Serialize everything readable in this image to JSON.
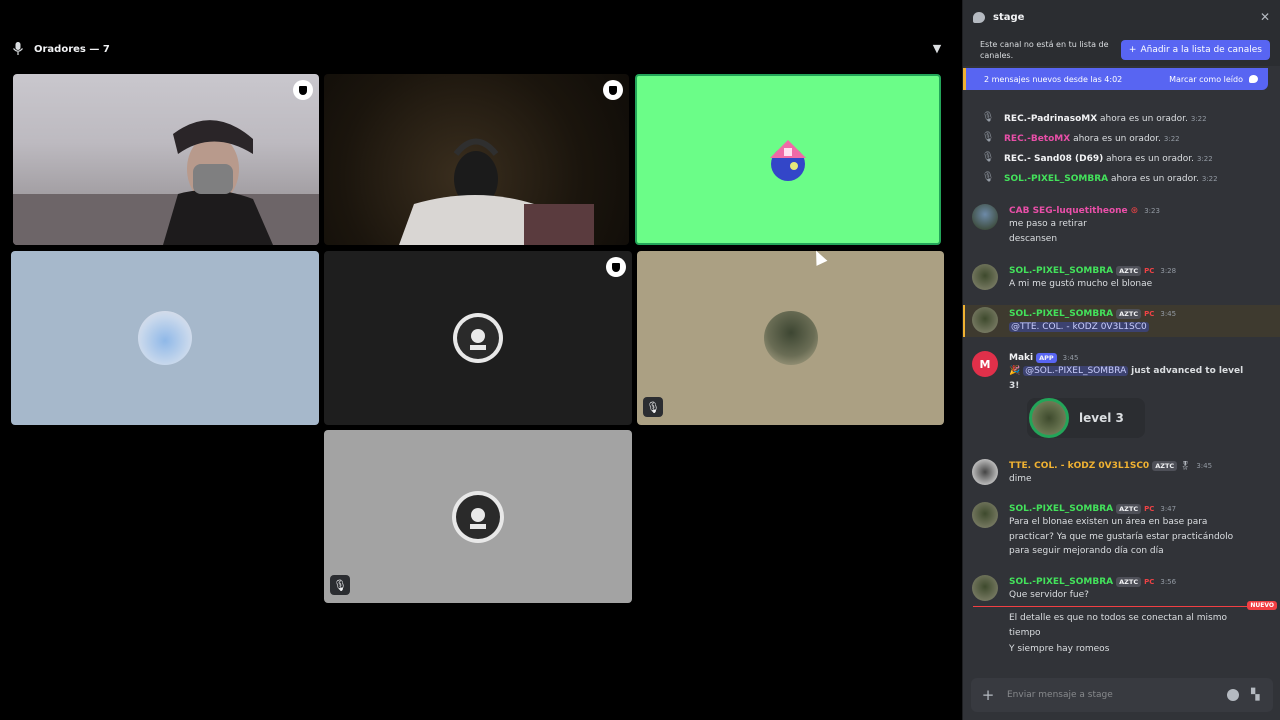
{
  "stage": {
    "speakers_label": "Oradores — 7"
  },
  "chat": {
    "channel_name": "stage",
    "notice_text": "Este canal no está en tu lista de canales.",
    "add_button_label": "Añadir a la lista de canales",
    "new_messages_text": "2 mensajes nuevos desde las 4:02",
    "mark_read_label": "Marcar como leído",
    "system_messages": [
      {
        "user": "REC.-PadrinasoMX",
        "user_color": "#f2f3f5",
        "text": "ahora es un orador.",
        "time": "3:22"
      },
      {
        "user": "REC.-BetoMX",
        "user_color": "#e94fa8",
        "text": "ahora es un orador.",
        "time": "3:22"
      },
      {
        "user": "REC.- Sand08 (D69)",
        "user_color": "#f2f3f5",
        "text": "ahora es un orador.",
        "time": "3:22"
      },
      {
        "user": "SOL.-PIXEL_SOMBRA",
        "user_color": "#43e25b",
        "text": "ahora es un orador.",
        "time": "3:22"
      }
    ],
    "messages": [
      {
        "user": "CAB SEG-luquetitheone",
        "user_color": "#e94fa8",
        "time": "3:23",
        "lines": [
          "me paso a retirar",
          "descansen"
        ]
      },
      {
        "user": "SOL.-PIXEL_SOMBRA",
        "user_color": "#43e25b",
        "tag": "AZTC",
        "badge": "PC",
        "time": "3:28",
        "lines": [
          "A mi me gustó mucho el blonae"
        ]
      },
      {
        "user": "SOL.-PIXEL_SOMBRA",
        "user_color": "#43e25b",
        "tag": "AZTC",
        "badge": "PC",
        "time": "3:45",
        "mention": "@TTE. COL. - kODZ 0V3L1SC0"
      },
      {
        "user": "Maki",
        "user_color": "#f2f3f5",
        "tag": "APP",
        "time": "3:45",
        "mention": "@SOL.-PIXEL_SOMBRA",
        "text_bold": "just advanced to level 3!",
        "level_card": "level 3"
      },
      {
        "user": "TTE. COL. - kODZ 0V3L1SC0",
        "user_color": "#f0b232",
        "tag": "AZTC",
        "time": "3:45",
        "lines": [
          "dime"
        ]
      },
      {
        "user": "SOL.-PIXEL_SOMBRA",
        "user_color": "#43e25b",
        "tag": "AZTC",
        "badge": "PC",
        "time": "3:47",
        "lines": [
          "Para el blonae existen un área en base para",
          "practicar? Ya que me gustaría estar practicándolo",
          "para seguir mejorando día con día"
        ]
      },
      {
        "user": "SOL.-PIXEL_SOMBRA",
        "user_color": "#43e25b",
        "tag": "AZTC",
        "badge": "PC",
        "time": "3:56",
        "lines": [
          "Que servidor fue?"
        ]
      }
    ],
    "new_label": "NUEVO",
    "after_new_lines": [
      "El detalle es que no todos se conectan al mismo",
      "tiempo",
      "Y siempre hay romeos"
    ],
    "composer_placeholder": "Enviar mensaje a stage"
  }
}
